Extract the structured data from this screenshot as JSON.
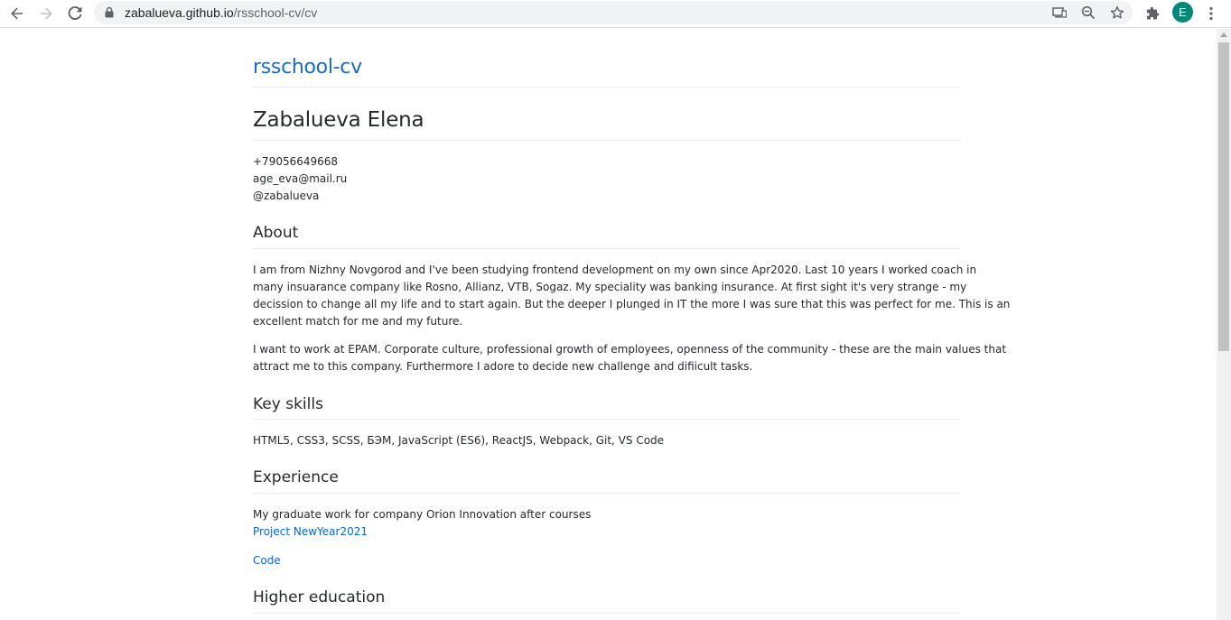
{
  "browser": {
    "url_host": "zabalueva.github.io",
    "url_path": "/rsschool-cv/cv",
    "profile_initial": "E",
    "icons": [
      "back-icon",
      "forward-icon",
      "reload-icon",
      "lock-icon",
      "cast-icon",
      "zoom-icon",
      "star-icon",
      "extensions-icon",
      "menu-icon"
    ]
  },
  "page": {
    "site_title": "rsschool-cv",
    "name": "Zabalueva Elena",
    "contacts": {
      "phone": "+79056649668",
      "email": "age_eva@mail.ru",
      "handle": "@zabalueva"
    },
    "about": {
      "heading": "About",
      "p1_lines": [
        "I am from Nizhny Novgorod and I've been studying frontend development on my own since Apr2020. Last 10 years I worked coach in",
        "many insuarance company like Rosno, Allianz, VTB, Sogaz. My speciality was banking insurance. At first sight it's very strange - my",
        "decission to change all my life and to start again. But the deeper I plunged in IT the more I was sure that this was perfect for me. This is an",
        "excellent match for me and my future."
      ],
      "p2_lines": [
        "I want to work at EPAM. Corporate culture, professional growth of employees, openness of the community - these are the main values that",
        "attract me to this company. Furthermore I adore to decide new challenge and difiicult tasks."
      ]
    },
    "skills": {
      "heading": "Key skills",
      "text": "HTML5, CSS3, SCSS, БЭМ, JavaScript (ES6), ReactJS, Webpack, Git, VS Code"
    },
    "experience": {
      "heading": "Experience",
      "text": "My graduate work for company Orion Innovation after courses",
      "project_link": "Project NewYear2021",
      "code_link": "Code"
    },
    "education": {
      "heading": "Higher education"
    }
  },
  "colors": {
    "link": "#0366d6",
    "title_link": "#1a6bc5",
    "text": "#24292e",
    "rule": "#eaecef",
    "avatar": "#00897b"
  }
}
